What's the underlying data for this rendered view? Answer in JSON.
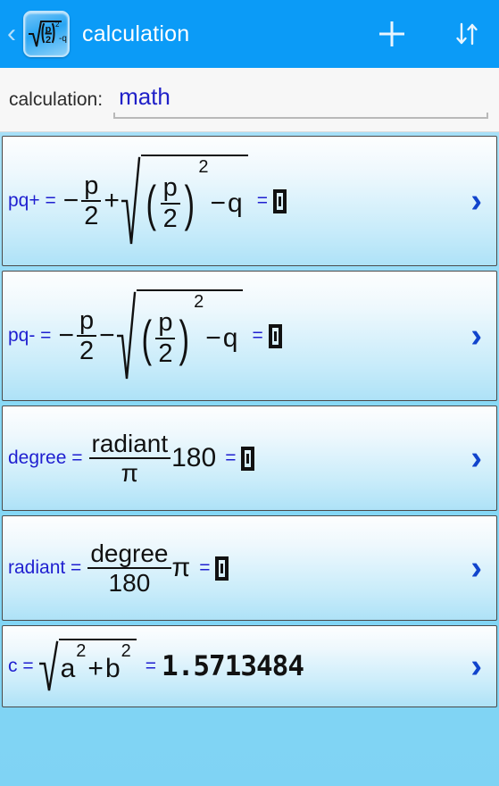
{
  "window": {
    "title": "calculation"
  },
  "actionbar": {
    "back_label": "‹",
    "app_icon_name": "pq-formula-app-icon",
    "title": "calculation",
    "add_label": "+",
    "sort_label": "↓↑"
  },
  "form": {
    "label": "calculation:",
    "value": "math",
    "placeholder": "calculation"
  },
  "colors": {
    "accent_blue": "#0b9bf7",
    "formula_blue": "#1f1fd0",
    "chevron_blue": "#1144cc",
    "row_gradient_top": "#fdfefe",
    "row_gradient_bottom": "#aee2f7",
    "page_background": "#86d8f6"
  },
  "formulas": [
    {
      "name": "pq+",
      "lhs": "pq+ =",
      "expression": "-p/2 + sqrt((p/2)^2 - q)",
      "equals": "=",
      "result": "",
      "result_is_empty": true,
      "parts": {
        "lead_sign": "−",
        "num": "p",
        "den": "2",
        "mid_op": "+",
        "inner_num": "p",
        "inner_den": "2",
        "exponent": "2",
        "tail_op": "−",
        "tail_var": "q"
      },
      "chevron": "›"
    },
    {
      "name": "pq-",
      "lhs": "pq- =",
      "expression": "-p/2 - sqrt((p/2)^2 - q)",
      "equals": "=",
      "result": "",
      "result_is_empty": true,
      "parts": {
        "lead_sign": "−",
        "num": "p",
        "den": "2",
        "mid_op": "−",
        "inner_num": "p",
        "inner_den": "2",
        "exponent": "2",
        "tail_op": "−",
        "tail_var": "q"
      },
      "chevron": "›"
    },
    {
      "name": "degree",
      "lhs": "degree =",
      "expression": "radiant / pi * 180",
      "equals": "=",
      "result": "",
      "result_is_empty": true,
      "parts": {
        "num": "radiant",
        "den": "π",
        "factor": "180"
      },
      "chevron": "›"
    },
    {
      "name": "radiant",
      "lhs": "radiant =",
      "expression": "degree / 180 * pi",
      "equals": "=",
      "result": "",
      "result_is_empty": true,
      "parts": {
        "num": "degree",
        "den": "180",
        "factor": "π"
      },
      "chevron": "›"
    },
    {
      "name": "c",
      "lhs": "c =",
      "expression": "sqrt(a^2 + b^2)",
      "equals": "=",
      "result": "1.5713484",
      "result_is_empty": false,
      "parts": {
        "var1": "a",
        "exp1": "2",
        "op": "+",
        "var2": "b",
        "exp2": "2"
      },
      "chevron": "›"
    }
  ]
}
